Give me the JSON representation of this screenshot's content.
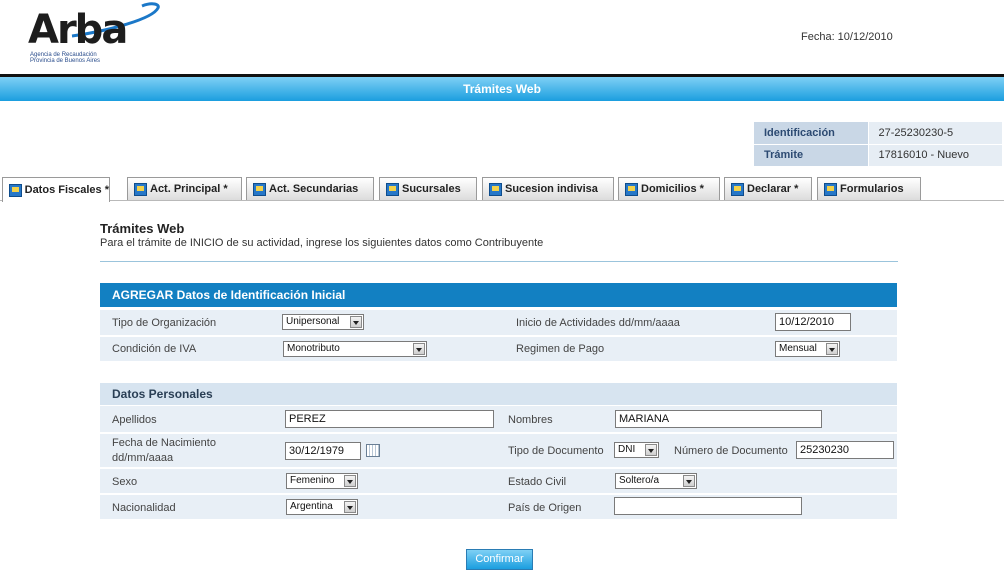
{
  "header": {
    "logo_text": "Arba",
    "logo_line1": "Agencia de Recaudación",
    "logo_line2": "Provincia de Buenos Aires",
    "fecha": "Fecha: 10/12/2010",
    "bar_title": "Trámites Web"
  },
  "info": {
    "id_label": "Identificación",
    "id_value": "27-25230230-5",
    "tramite_label": "Trámite",
    "tramite_value": "17816010 - Nuevo"
  },
  "tabs": [
    {
      "label": "Datos Fiscales *",
      "icon": "doc-icon",
      "active": true
    },
    {
      "label": "Act. Principal *",
      "icon": "doc-icon"
    },
    {
      "label": "Act. Secundarias",
      "icon": "doc-icon"
    },
    {
      "label": "Sucursales",
      "icon": "doc-icon"
    },
    {
      "label": "Sucesion indivisa",
      "icon": "doc-icon"
    },
    {
      "label": "Domicilios *",
      "icon": "doc-icon"
    },
    {
      "label": "Declarar *",
      "icon": "doc-icon"
    },
    {
      "label": "Formularios",
      "icon": "doc-icon"
    }
  ],
  "section": {
    "title": "Trámites Web",
    "description": "Para el trámite de INICIO de su actividad, ingrese los siguientes datos como Contribuyente"
  },
  "ident": {
    "heading": "AGREGAR Datos de Identificación Inicial",
    "tipo_org_label": "Tipo de Organización",
    "tipo_org_value": "Unipersonal",
    "inicio_label": "Inicio de Actividades dd/mm/aaaa",
    "inicio_value": "10/12/2010",
    "iva_label": "Condición de IVA",
    "iva_value": "Monotributo",
    "regimen_label": "Regimen de Pago",
    "regimen_value": "Mensual"
  },
  "personal": {
    "heading": "Datos Personales",
    "apellidos_label": "Apellidos",
    "apellidos_value": "PEREZ",
    "nombres_label": "Nombres",
    "nombres_value": "MARIANA",
    "nac_label_1": "Fecha de Nacimiento",
    "nac_label_2": "dd/mm/aaaa",
    "nac_value": "30/12/1979",
    "tipo_doc_label": "Tipo de Documento",
    "tipo_doc_value": "DNI",
    "num_doc_label": "Número de Documento",
    "num_doc_value": "25230230",
    "sexo_label": "Sexo",
    "sexo_value": "Femenino",
    "estado_label": "Estado Civil",
    "estado_value": "Soltero/a",
    "nacionalidad_label": "Nacionalidad",
    "nacionalidad_value": "Argentina",
    "pais_label": "País de Origen",
    "pais_value": ""
  },
  "actions": {
    "confirm": "Confirmar"
  },
  "colors": {
    "accent": "#1b9edf",
    "panel_head": "#1280c2",
    "row_bg": "#e8eff6"
  }
}
